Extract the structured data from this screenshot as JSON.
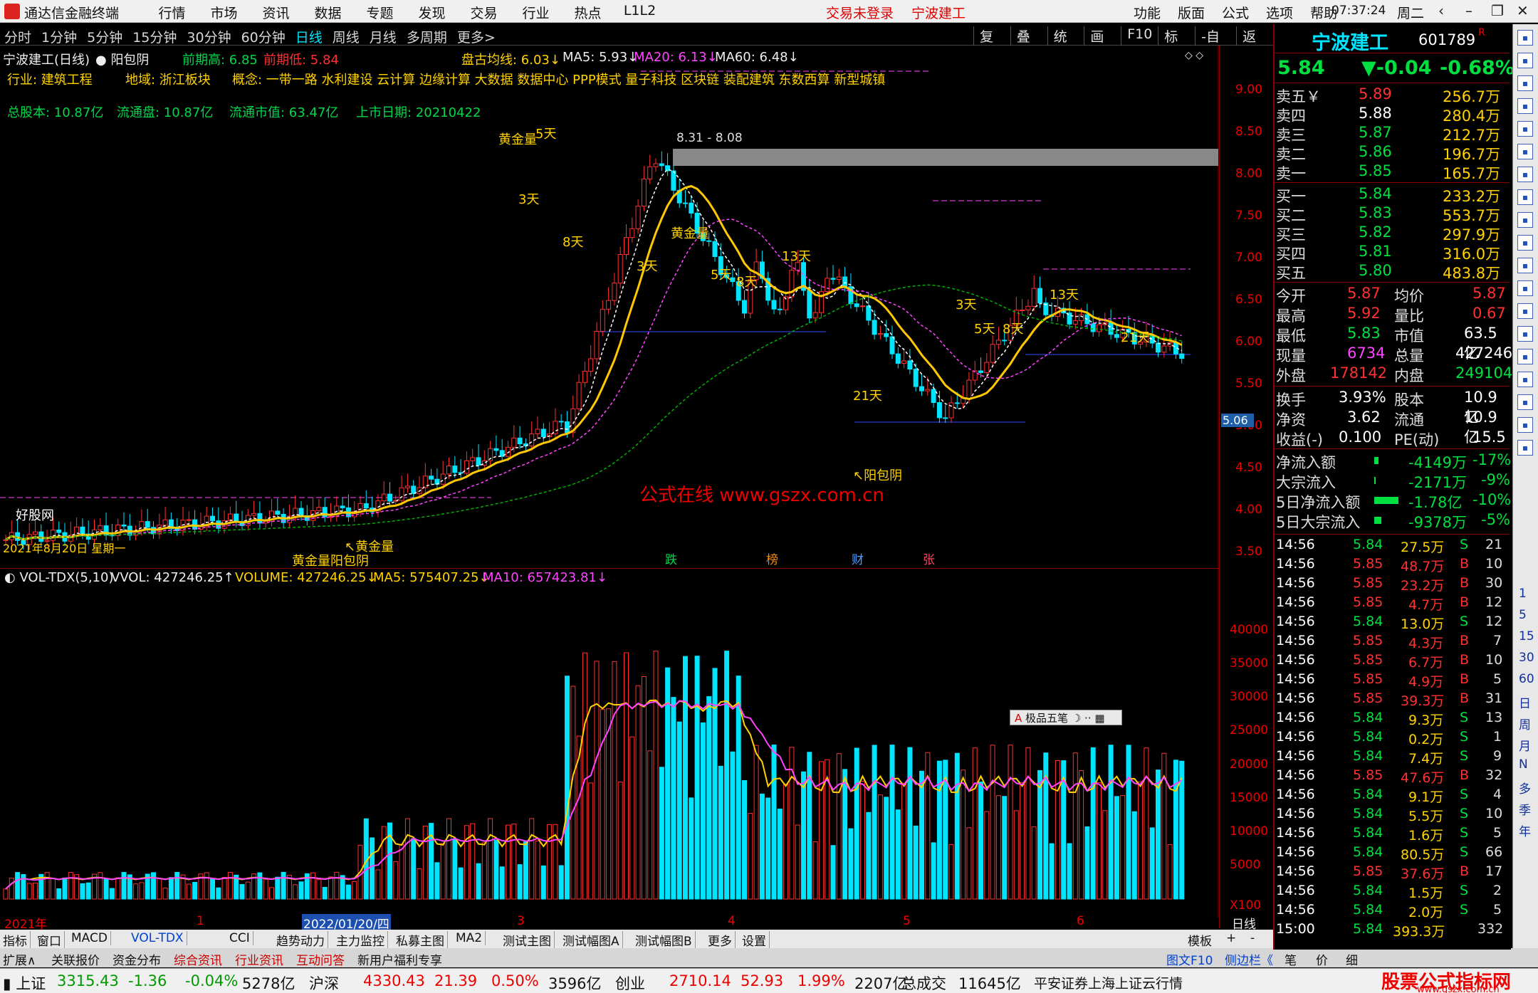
{
  "titlebar": {
    "app_name": "通达信金融终端",
    "menu": [
      "行情",
      "市场",
      "资讯",
      "数据",
      "专题",
      "发现",
      "交易",
      "行业",
      "热点",
      "L1L2"
    ],
    "trade_status": "交易未登录",
    "stock_name": "宁波建工",
    "right_menu": [
      "功能",
      "版面",
      "公式",
      "选项",
      "帮助"
    ],
    "time": "07:37:24",
    "weekday": "周二",
    "window_buttons": [
      "back-icon",
      "minimize-icon",
      "restore-icon",
      "close-icon"
    ]
  },
  "toolbar": {
    "periods": [
      "分时",
      "1分钟",
      "5分钟",
      "15分钟",
      "30分钟",
      "60分钟",
      "日线",
      "周线",
      "月线",
      "多周期",
      "更多>"
    ],
    "active_period": "日线",
    "tools": [
      "复权",
      "叠加",
      "统计",
      "画线",
      "F10",
      "标记",
      "-自选",
      "返回"
    ]
  },
  "chart_header": {
    "title": "宁波建工(日线)",
    "pattern": "阳包阴",
    "prev_high": "前期高: 6.85",
    "prev_low": "前期低: 5.84",
    "avg_line": "盘古均线: 6.03↓",
    "ma5": "MA5: 5.93↓",
    "ma20": "MA20: 6.13↓",
    "ma60": "MA60: 6.48↓",
    "industry": "行业:  建筑工程",
    "region": "地域:  浙江板块",
    "concepts": "概念:  一带一路 水利建设 云计算 边缘计算 大数据 数据中心 PPP模式 量子科技 区块链 装配建筑 东数西算 新型城镇",
    "total_shares": "总股本: 10.87亿",
    "float_shares": "流通盘: 10.87亿",
    "float_value": "流通市值: 63.47亿",
    "list_date": "上市日期: 20210422"
  },
  "annotations": {
    "zone_label": "8.31 - 8.08",
    "price_tag": "5.06",
    "watermark": "公式在线  www.gszx.com.cn",
    "site_label": "好股网",
    "date_label": "2021年8月20日 星期一",
    "labels": [
      {
        "text": "黄金量",
        "key": "a1"
      },
      {
        "text": "5天",
        "key": "a2"
      },
      {
        "text": "3天",
        "key": "a3"
      },
      {
        "text": "8天",
        "key": "a4"
      },
      {
        "text": "黄金量",
        "key": "a5"
      },
      {
        "text": "3天",
        "key": "a6"
      },
      {
        "text": "5天",
        "key": "a7"
      },
      {
        "text": "8天",
        "key": "a8"
      },
      {
        "text": "13天",
        "key": "a9"
      },
      {
        "text": "21天",
        "key": "a10"
      },
      {
        "text": "↖阳包阴",
        "key": "a11"
      },
      {
        "text": "3天",
        "key": "a12"
      },
      {
        "text": "5天",
        "key": "a13"
      },
      {
        "text": "8天",
        "key": "a14"
      },
      {
        "text": "13天",
        "key": "a15"
      },
      {
        "text": "21天",
        "key": "a16"
      },
      {
        "text": "↖黄金量",
        "key": "a17"
      },
      {
        "text": "黄金量阳包阴",
        "key": "a18"
      }
    ],
    "markers": [
      "跌",
      "榜",
      "财",
      "张"
    ]
  },
  "price_axis": [
    "9.00",
    "8.50",
    "8.00",
    "7.50",
    "7.00",
    "6.50",
    "6.00",
    "5.50",
    "5.00",
    "4.50",
    "4.00",
    "3.50"
  ],
  "volume_header": {
    "name": "VOL-TDX(5,10)",
    "vvol": "VVOL: 427246.25↑",
    "volume": "VOLUME: 427246.25↓",
    "ma5": "MA5: 575407.25↓",
    "ma10": "MA10: 657423.81↓"
  },
  "volume_axis": [
    "40000",
    "35000",
    "30000",
    "25000",
    "20000",
    "15000",
    "10000",
    "5000",
    "X100"
  ],
  "ime_box": "极品五笔",
  "date_axis": {
    "labels": [
      "2021年",
      "1",
      "2022/01/20/四",
      "3",
      "4",
      "5",
      "6"
    ],
    "right": "日线"
  },
  "bottom_tabs": [
    "指标",
    "窗口",
    "MACD",
    "VOL-TDX",
    "CCI",
    "趋势动力",
    "主力监控",
    "私募主图",
    "MA2",
    "测试主图",
    "测试幅图A",
    "测试幅图B",
    "更多",
    "设置"
  ],
  "bottom_tabs_right": [
    "模板",
    "+",
    "-"
  ],
  "bottom_tabs2": [
    "扩展∧",
    "关联报价",
    "资金分布",
    "综合资讯",
    "行业资讯",
    "互动问答",
    "新用户福利专享"
  ],
  "bottom_tabs2_right": [
    "图文F10",
    "侧边栏《",
    "笔",
    "价",
    "细"
  ],
  "statusbar": {
    "items": [
      {
        "name": "上证",
        "price": "3315.43",
        "chg": "-1.36",
        "pct": "-0.04%",
        "amt": "5278亿",
        "up": false
      },
      {
        "name": "沪深",
        "price": "4330.43",
        "chg": "21.39",
        "pct": "0.50%",
        "amt": "3596亿",
        "up": true
      },
      {
        "name": "创业",
        "price": "2710.14",
        "chg": "52.93",
        "pct": "1.99%",
        "amt": "2207亿",
        "up": true
      }
    ],
    "total_label": "总成交",
    "total": "11645亿",
    "broker": "平安证券上海上证云行情",
    "brand": "股票公式指标网",
    "brand_url": "www.gszx.com.cn"
  },
  "quote": {
    "name": "宁波建工",
    "code": "601789",
    "flag": "R",
    "price": "5.84",
    "change": "▼-0.04",
    "pct": "-0.68%",
    "asks": [
      {
        "label": "卖五￥",
        "price": "5.89",
        "vol": "256.7万"
      },
      {
        "label": "卖四",
        "price": "5.88",
        "vol": "280.4万"
      },
      {
        "label": "卖三",
        "price": "5.87",
        "vol": "212.7万"
      },
      {
        "label": "卖二",
        "price": "5.86",
        "vol": "196.7万"
      },
      {
        "label": "卖一",
        "price": "5.85",
        "vol": "165.7万"
      }
    ],
    "bids": [
      {
        "label": "买一",
        "price": "5.84",
        "vol": "233.2万"
      },
      {
        "label": "买二",
        "price": "5.83",
        "vol": "553.7万"
      },
      {
        "label": "买三",
        "price": "5.82",
        "vol": "297.9万"
      },
      {
        "label": "买四",
        "price": "5.81",
        "vol": "316.0万"
      },
      {
        "label": "买五",
        "price": "5.80",
        "vol": "483.8万"
      }
    ],
    "stats": [
      {
        "l1": "今开",
        "v1": "5.87",
        "l2": "均价",
        "v2": "5.87",
        "c1": "red",
        "c2": "red"
      },
      {
        "l1": "最高",
        "v1": "5.92",
        "l2": "量比",
        "v2": "0.67",
        "c1": "red",
        "c2": "red"
      },
      {
        "l1": "最低",
        "v1": "5.83",
        "l2": "市值",
        "v2": "63.5亿",
        "c1": "grn",
        "c2": "wht"
      },
      {
        "l1": "现量",
        "v1": "6734",
        "l2": "总量",
        "v2": "427246",
        "c1": "mag",
        "c2": "wht"
      },
      {
        "l1": "外盘",
        "v1": "178142",
        "l2": "内盘",
        "v2": "249104",
        "c1": "red",
        "c2": "grn"
      }
    ],
    "stats2": [
      {
        "l1": "换手",
        "v1": "3.93%",
        "l2": "股本",
        "v2": "10.9亿"
      },
      {
        "l1": "净资",
        "v1": "3.62",
        "l2": "流通",
        "v2": "10.9亿"
      },
      {
        "l1": "收益(-)",
        "v1": "0.100",
        "l2": "PE(动)",
        "v2": "15.5"
      }
    ],
    "flows": [
      {
        "label": "净流入额",
        "value": "-4149万",
        "pct": "-17%"
      },
      {
        "label": "大宗流入",
        "value": "-2171万",
        "pct": "-9%"
      },
      {
        "label": "5日净流入额",
        "value": "-1.78亿",
        "pct": "-10%"
      },
      {
        "label": "5日大宗流入",
        "value": "-9378万",
        "pct": "-5%"
      }
    ],
    "ticks": [
      {
        "t": "14:56",
        "p": "5.84",
        "v": "27.5万",
        "s": "S",
        "n": "21"
      },
      {
        "t": "14:56",
        "p": "5.85",
        "v": "48.7万",
        "s": "B",
        "n": "10"
      },
      {
        "t": "14:56",
        "p": "5.85",
        "v": "23.2万",
        "s": "B",
        "n": "30"
      },
      {
        "t": "14:56",
        "p": "5.85",
        "v": "4.7万",
        "s": "B",
        "n": "12"
      },
      {
        "t": "14:56",
        "p": "5.84",
        "v": "13.0万",
        "s": "S",
        "n": "12"
      },
      {
        "t": "14:56",
        "p": "5.85",
        "v": "4.3万",
        "s": "B",
        "n": "7"
      },
      {
        "t": "14:56",
        "p": "5.85",
        "v": "6.7万",
        "s": "B",
        "n": "10"
      },
      {
        "t": "14:56",
        "p": "5.85",
        "v": "4.9万",
        "s": "B",
        "n": "5"
      },
      {
        "t": "14:56",
        "p": "5.85",
        "v": "39.3万",
        "s": "B",
        "n": "31"
      },
      {
        "t": "14:56",
        "p": "5.84",
        "v": "9.3万",
        "s": "S",
        "n": "13"
      },
      {
        "t": "14:56",
        "p": "5.84",
        "v": "0.2万",
        "s": "S",
        "n": "1"
      },
      {
        "t": "14:56",
        "p": "5.84",
        "v": "7.4万",
        "s": "S",
        "n": "9"
      },
      {
        "t": "14:56",
        "p": "5.85",
        "v": "47.6万",
        "s": "B",
        "n": "32"
      },
      {
        "t": "14:56",
        "p": "5.84",
        "v": "9.1万",
        "s": "S",
        "n": "4"
      },
      {
        "t": "14:56",
        "p": "5.84",
        "v": "5.5万",
        "s": "S",
        "n": "10"
      },
      {
        "t": "14:56",
        "p": "5.84",
        "v": "1.6万",
        "s": "S",
        "n": "5"
      },
      {
        "t": "14:56",
        "p": "5.84",
        "v": "80.5万",
        "s": "S",
        "n": "66"
      },
      {
        "t": "14:56",
        "p": "5.85",
        "v": "37.6万",
        "s": "B",
        "n": "17"
      },
      {
        "t": "14:56",
        "p": "5.84",
        "v": "1.5万",
        "s": "S",
        "n": "2"
      },
      {
        "t": "14:56",
        "p": "5.84",
        "v": "2.0万",
        "s": "S",
        "n": "5"
      },
      {
        "t": "15:00",
        "p": "5.84",
        "v": "393.3万",
        "s": "",
        "n": "332"
      }
    ]
  },
  "right_toolbar": [
    "1",
    "5",
    "15",
    "30",
    "60",
    "日",
    "周",
    "月",
    "N",
    "多",
    "季",
    "年"
  ],
  "colors": {
    "up": "#ff3030",
    "down": "#00e5ff",
    "ma_yellow": "#ffc800",
    "ma_white": "#ffffff",
    "ma_mag": "#ff44ff",
    "ma_green": "#00b000"
  }
}
